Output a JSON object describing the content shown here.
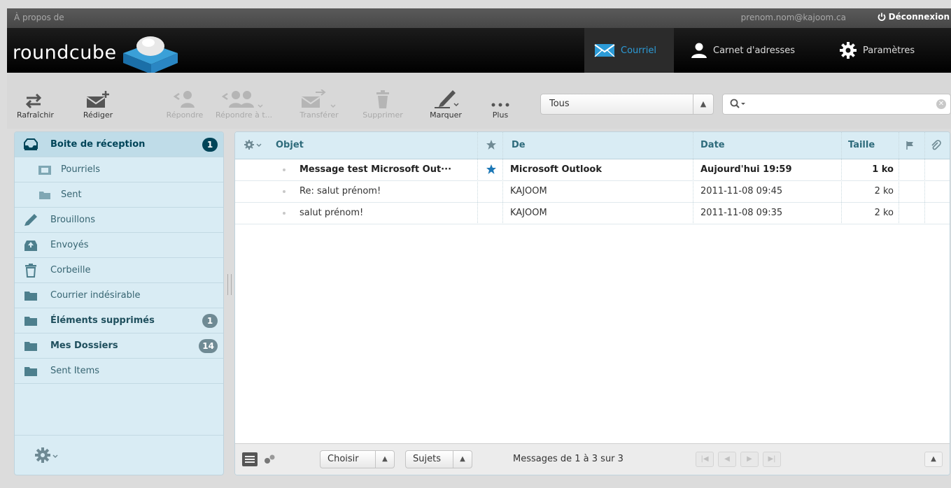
{
  "topline": {
    "about": "À propos de",
    "user": "prenom.nom@kajoom.ca",
    "logout": "Déconnexion"
  },
  "logo": {
    "text": "roundcube"
  },
  "tasks": [
    {
      "label": "Courriel",
      "icon": "envelope-icon",
      "active": true
    },
    {
      "label": "Carnet d'adresses",
      "icon": "person-icon",
      "active": false
    },
    {
      "label": "Paramètres",
      "icon": "gear-icon",
      "active": false
    }
  ],
  "toolbar": {
    "refresh": "Rafraîchir",
    "compose": "Rédiger",
    "reply": "Répondre",
    "reply_all": "Répondre à t...",
    "forward": "Transférer",
    "delete": "Supprimer",
    "mark": "Marquer",
    "more": "Plus"
  },
  "filter": {
    "value": "Tous"
  },
  "search": {
    "placeholder": ""
  },
  "folders": [
    {
      "label": "Boite de réception",
      "icon": "inbox-icon",
      "badge": "1",
      "selected": true
    },
    {
      "label": "Pourriels",
      "icon": "junk-folder-icon",
      "sub": true
    },
    {
      "label": "Sent",
      "icon": "folder-icon",
      "sub": true
    },
    {
      "label": "Brouillons",
      "icon": "pencil-icon"
    },
    {
      "label": "Envoyés",
      "icon": "sent-icon"
    },
    {
      "label": "Corbeille",
      "icon": "trash-icon"
    },
    {
      "label": "Courrier indésirable",
      "icon": "folder-icon"
    },
    {
      "label": "Éléments supprimés",
      "icon": "folder-icon",
      "badge": "1",
      "bold": true
    },
    {
      "label": "Mes Dossiers",
      "icon": "folder-icon",
      "badge": "14",
      "bold": true
    },
    {
      "label": "Sent Items",
      "icon": "folder-icon"
    }
  ],
  "list": {
    "headers": {
      "subject": "Objet",
      "from": "De",
      "date": "Date",
      "size": "Taille"
    },
    "rows": [
      {
        "subject": "Message test Microsoft Out···",
        "flagged": true,
        "from": "Microsoft Outlook",
        "date": "Aujourd'hui 19:59",
        "size": "1 ko",
        "unread": true
      },
      {
        "subject": "Re: salut prénom!",
        "flagged": false,
        "from": "KAJOOM",
        "date": "2011-11-08 09:45",
        "size": "2 ko",
        "unread": false
      },
      {
        "subject": "salut prénom!",
        "flagged": false,
        "from": "KAJOOM",
        "date": "2011-11-08 09:35",
        "size": "2 ko",
        "unread": false
      }
    ]
  },
  "footer": {
    "select": "Choisir",
    "threads": "Sujets",
    "count": "Messages de 1 à 3 sur 3"
  },
  "colors": {
    "accent": "#2c9bd7",
    "folder_bg": "#d9ecf4",
    "header_bg": "#000000"
  }
}
